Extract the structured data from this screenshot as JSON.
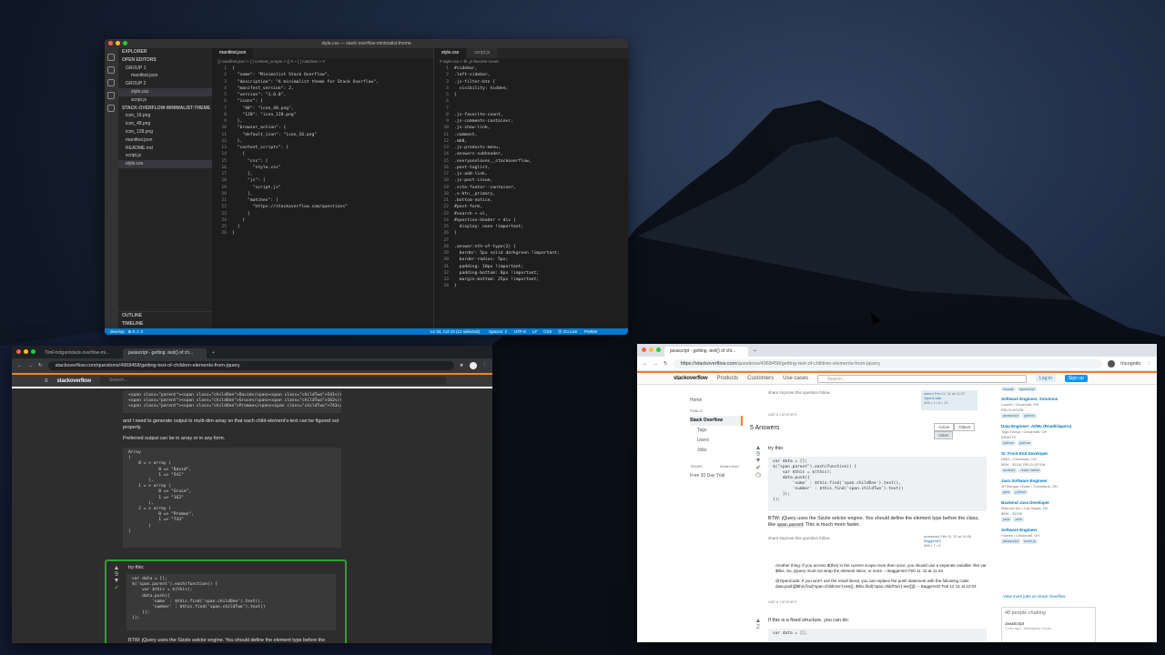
{
  "vscode": {
    "window_title": "style.css — stack-overflow-minimalist-theme",
    "sidebar": {
      "explorer": "EXPLORER",
      "open_editors": "OPEN EDITORS",
      "group1": "GROUP 1",
      "group1_files": [
        "manifest.json"
      ],
      "group2": "GROUP 2",
      "group2_files": [
        "style.css",
        "script.js"
      ],
      "project": "STACK-OVERFLOW-MINIMALIST-THEME",
      "files": [
        "icon_16.png",
        "icon_48.png",
        "icon_128.png",
        "manifest.json",
        "README.md",
        "script.js",
        "style.css"
      ],
      "outline": "OUTLINE",
      "timeline": "TIMELINE"
    },
    "left_editor": {
      "tab": "manifest.json",
      "breadcrumb": "{} manifest.json > [ ] content_scripts > {} 0 > [ ] matches > 0",
      "lines": [
        "{",
        "  \"name\": \"Minimalist Stack Overflow\",",
        "  \"description\": \"A minimalist theme for Stack Overflow\",",
        "  \"manifest_version\": 2,",
        "  \"version\": \"1.0.0\",",
        "  \"icons\": {",
        "    \"48\": \"icon_48.png\",",
        "    \"128\": \"icon_128.png\"",
        "  },",
        "  \"browser_action\": {",
        "    \"default_icon\": \"icon_16.png\"",
        "  },",
        "  \"content_scripts\": [",
        "    {",
        "      \"css\": [",
        "        \"style.css\"",
        "      ],",
        "      \"js\": [",
        "        \"script.js\"",
        "      ],",
        "      \"matches\": [",
        "        \"https://stackoverflow.com/questions\"",
        "      ]",
        "    }",
        "  ]",
        "}"
      ]
    },
    "right_editor": {
      "tab_active": "style.css",
      "tab_other": "script.js",
      "breadcrumb": "# style.css > ⚙ .js-favorite-count",
      "lines": [
        "#sidebar,",
        ".left-sidebar,",
        ".js-filter-btn {",
        "  visibility: hidden;",
        "}",
        "",
        "",
        ".js-favorite-count,",
        ".js-comments-container,",
        ".js-show-link,",
        ".comment,",
        ".mb8,",
        ".js-products-menu,",
        ".answers-subheader,",
        ".everyoneloves__stackoverflow,",
        ".post-taglist,",
        ".js-add-link,",
        ".js-post-issue,",
        ".site-footer--container,",
        ".s-btn__primary,",
        ".bottom-notice,",
        "#post-form,",
        "#search + ol,",
        "#question-header + div {",
        "  display: none !important;",
        "}",
        "",
        ".answer:nth-of-type(2) {",
        "  border: 5px solid darkgreen !important;",
        "  border-radius: 5px;",
        "  padding: 10px !important;",
        "  padding-bottom: 0px !important;",
        "  margin-bottom: 25px !important;",
        "}"
      ]
    },
    "status": {
      "branch": "develop",
      "problems": "⊗ 0 ⚠ 0",
      "position": "Ln 34, Col 15 (12 selected)",
      "spaces": "Spaces: 2",
      "encoding": "UTF-8",
      "eol": "LF",
      "language": "CSS",
      "golive": "⦿ Go Live",
      "prettier": "Prettier"
    }
  },
  "left_browser": {
    "tab1": "TimFrirdgan/stack-overflow-mi...",
    "tab2": "javascript - getting .text() of ch...",
    "url": "stackoverflow.com/questions/4968458/getting-text-of-children-elements-from-jquery",
    "logo": "stackoverflow",
    "search_placeholder": "Search...",
    "code_top": [
      "<span class=\"parent\"><span class=\"childOne\">David</span><span class=\"childTwo\">541</span>",
      "<span class=\"parent\"><span class=\"childOne\">Gruce</span><span class=\"childTwo\">162</span>",
      "<span class=\"parent\"><span class=\"childOne\">Proman</span><span class=\"childTwo\">743</span>"
    ],
    "text1": "and I need to generate output in multi-dim-array so that each child-element's-text can be figured out properly.",
    "text2": "Preferred output can be in array or in any form.",
    "array_lines": [
      "Array",
      "(",
      "    0 = > array (",
      "            0 => \"David\",",
      "            1 => \"541\"",
      "        ),",
      "",
      "    1 = > array (",
      "            0 => \"Gruce\",",
      "            1 => \"162\"",
      "        ),",
      "",
      "    2 = > array (",
      "            0 => \"Proman\",",
      "            1 => \"743\"",
      "        )",
      ")"
    ],
    "answer_intro": "try this:",
    "vote_count": "9",
    "answer_code": [
      "var data = [];",
      "",
      "$('span.parent').each(function() {",
      "    var $this = $(this);",
      "    data.push({",
      "        'name' : $this.find('span.childOne').text(),",
      "        'number' : $this.find('span.childTwo').text()",
      "    });",
      "});"
    ],
    "answer_tail": "BTW: jQuery uses the Sizzle selctor engine. You should define the element type before the"
  },
  "right_browser": {
    "tab": "javascript - getting .text() of chi...",
    "url_host": "https://stackoverflow.com",
    "url_path": "/questions/4968458/getting-text-of-children-elements-from-jquery",
    "incognito": "Incognito",
    "nav": [
      "Products",
      "Customers",
      "Use cases"
    ],
    "search_placeholder": "Search...",
    "login": "Log in",
    "signup": "Sign up",
    "left_nav": {
      "home": "Home",
      "public": "PUBLIC",
      "stackoverflow": "Stack Overflow",
      "tags": "Tags",
      "users": "Users",
      "jobs": "Jobs",
      "teams": "TEAMS",
      "whats_this": "What's this?",
      "trial": "Free 30 Day Trial"
    },
    "share_line": "share  improve this question  follow",
    "asked": "asked Feb 11 '11 at 11:37",
    "asker": "OpenCode",
    "asker_rep": "538 • 1 • 6 • 12",
    "add_comment": "add a comment",
    "answers_count": "5 Answers",
    "sort": [
      "Active",
      "Oldest",
      "Votes"
    ],
    "answer_intro": "try this:",
    "vote_count": "9",
    "answer_code": [
      "var data = [];",
      "",
      "$(\"span.parent\").each(function() {",
      "    var $this = $(this);",
      "    data.push({",
      "        'name' : $this.find('span.childOne').text(),",
      "        'number' : $this.find('span.childTwo').text()",
      "    });",
      "});"
    ],
    "btw": "BTW: jQuery uses the Sizzle selctor engine. You should define the element type before the class, like",
    "btw_code": "span.parent",
    "btw_end": "This is much more faster.",
    "answered": "answered Feb 11 '11 at 11:45",
    "answerer": "BaggersIO",
    "answerer_rep": "696 • 7 • 9",
    "comment1": "Another thing: If you access $(this) in the current scope more then once, you should use a seperate variable: like var $this. So, jQuery must not wrap the element twice, or more. – BaggersIO Feb 11 '11 at 11:43",
    "comment2": "@OpenCode: If you won't use the result literal, you can replace the push statement with the following code: data.push([$this.find('span.childOne').text(), $this.find('span.childTwo').text()]); – BaggersIO Feb 11 '11 at 12:03",
    "second_answer": "If this is a fixed structure, you can do:",
    "second_vote": "2",
    "second_code": "var data = [];",
    "jobs": [
      {
        "title": "Software Engineer, Solutions",
        "company": "Locent",
        "loc": "Cincinnati, OH",
        "extra": "RELOCATION",
        "tags": [
          "javascript",
          "python"
        ]
      },
      {
        "title": "Data Engineer: AI/ML (Roadtrippers)",
        "company": "Togo Group",
        "loc": "Cincinnati, OH",
        "extra": "REMOTE",
        "tags": [
          "python",
          "python"
        ]
      },
      {
        "title": "Sr. Front End Developer",
        "company": "DMG",
        "loc": "Cincinnati, OH",
        "extra": "$83K - $110K  RELOCATION",
        "tags": [
          "android",
          "react-native"
        ]
      },
      {
        "title": "Java Software Engineer",
        "company": "JP Morgan Chase",
        "loc": "Columbus, OH",
        "extra": "",
        "tags": [
          "java",
          "python"
        ]
      },
      {
        "title": "Backend Java Developer",
        "company": "Maxonic Inc",
        "loc": "Las Vegas, NV",
        "extra": "$90K - $100K",
        "tags": [
          "java",
          "aem"
        ]
      },
      {
        "title": "Software Engineer",
        "company": "Homes",
        "loc": "Cincinnati, OH",
        "extra": "",
        "tags": [
          "javascript",
          "node.js"
        ]
      }
    ],
    "top_tags": [
      "reactjs",
      "typescript"
    ],
    "more_jobs": "View more jobs on Stack Overflow",
    "chat": "48 people chatting",
    "chat_room": "JavaScript",
    "chat_meta": "1 min ago - Midnightly Coder"
  }
}
